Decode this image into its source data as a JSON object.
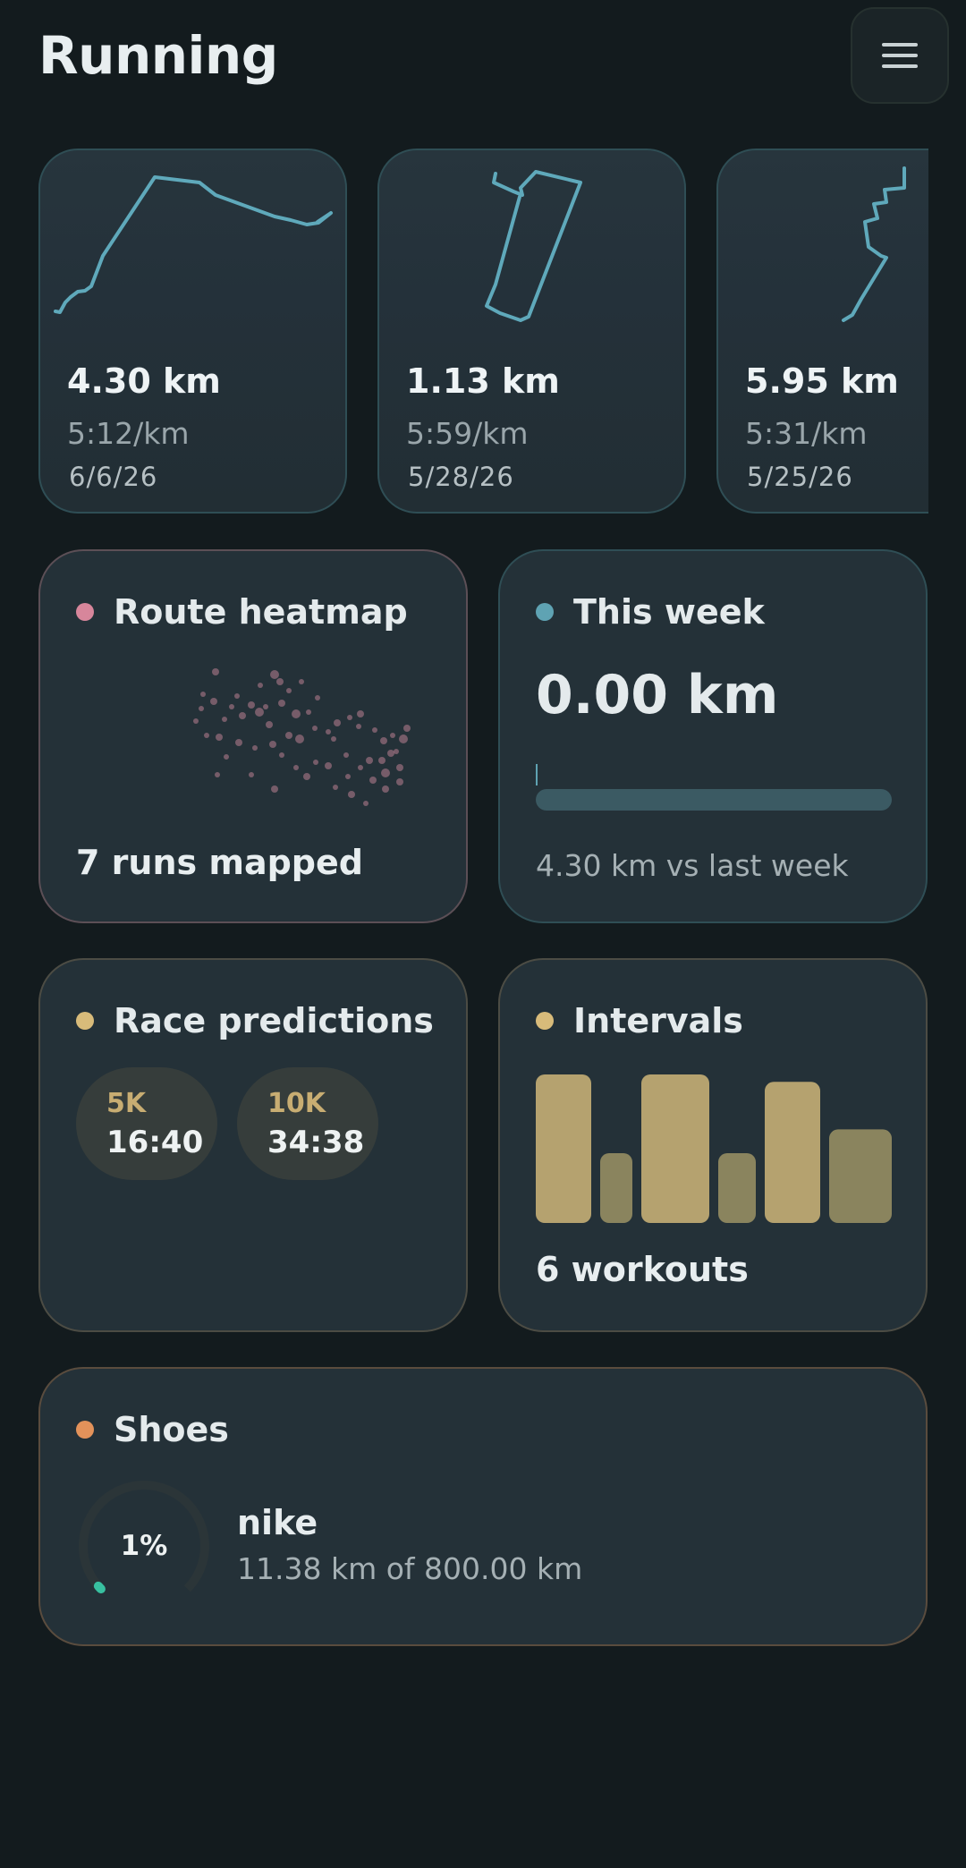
{
  "header": {
    "title": "Running",
    "menu_icon": "hamburger-menu-icon"
  },
  "runs": [
    {
      "distance": "4.30 km",
      "pace": "5:12/km",
      "date": "6/6/26"
    },
    {
      "distance": "1.13 km",
      "pace": "5:59/km",
      "date": "5/28/26"
    },
    {
      "distance": "5.95 km",
      "pace": "5:31/km",
      "date": "5/25/26"
    }
  ],
  "heatmap": {
    "title": "Route heatmap",
    "footer": "7 runs mapped",
    "accent": "#d7869b"
  },
  "week": {
    "title": "This week",
    "value": "0.00 km",
    "progress": 0,
    "compare": "4.30 km vs last week",
    "accent": "#5fa3b3"
  },
  "race": {
    "title": "Race predictions",
    "accent": "#d8bb7a",
    "predictions": [
      {
        "label": "5K",
        "time": "16:40"
      },
      {
        "label": "10K",
        "time": "34:38"
      }
    ]
  },
  "intervals": {
    "title": "Intervals",
    "footer": "6 workouts",
    "accent": "#d8bb7a",
    "bar_levels": [
      1.0,
      0.47,
      1.0,
      0.47,
      0.95,
      0.63
    ]
  },
  "shoes": {
    "title": "Shoes",
    "accent": "#e3925a",
    "items": [
      {
        "name": "nike",
        "percent": "1%",
        "progress": 0.014,
        "distance": "11.38 km of 800.00 km"
      }
    ]
  },
  "colors": {
    "route_line": "#5fa9bb",
    "bar_tall": "#b5a26f",
    "bar_short": "#8a845e",
    "shoe_ring": "#38c0a0"
  }
}
